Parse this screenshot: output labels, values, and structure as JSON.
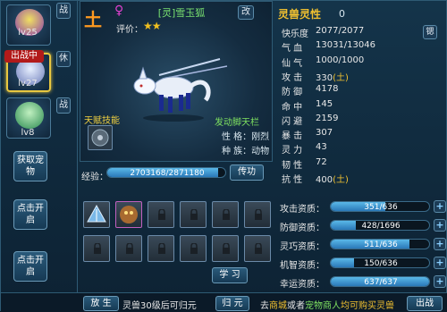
{
  "left": {
    "slots": [
      {
        "level": "lv25",
        "tag": "战"
      },
      {
        "level": "lv27",
        "tag": "休",
        "badge": "出战中"
      },
      {
        "level": "lv8",
        "tag": "战"
      }
    ],
    "get_pet_label": "获取宠物",
    "open_label_1": "点击开启",
    "open_label_2": "点击开启"
  },
  "pet": {
    "element": "土",
    "gender_icon": "female-icon",
    "name": "[灵]雪玉狐",
    "rename": "改",
    "rating_label": "评价：",
    "rating_stars": 2,
    "skills_label": "天赋技能",
    "discover_label": "发动脚天栏",
    "personality": "性 格：刚烈",
    "species": "种 族：动物"
  },
  "exp": {
    "label": "经验：",
    "text": "2703168/2871180",
    "fraction": 0.941,
    "pass_label": "传功"
  },
  "equip": {
    "learn_label": "学 习"
  },
  "spirit": {
    "title": "灵兽灵性",
    "value": "0",
    "reset": "锶",
    "stats": [
      {
        "k": "快乐度",
        "v": "2077/2077"
      },
      {
        "k": "气  血",
        "v": "13031/13046"
      },
      {
        "k": "仙  气",
        "v": "1000/1000"
      },
      {
        "k": "攻  击",
        "v": "330",
        "bonus": "(土)"
      },
      {
        "k": "防  御",
        "v": "4178"
      },
      {
        "k": "命  中",
        "v": "145"
      },
      {
        "k": "闪  避",
        "v": "2159"
      },
      {
        "k": "暴  击",
        "v": "307"
      },
      {
        "k": "灵  力",
        "v": "43"
      },
      {
        "k": "韧  性",
        "v": "72"
      },
      {
        "k": "抗  性",
        "v": "400",
        "bonus": "(土)"
      }
    ],
    "aptitudes": [
      {
        "label": "攻击资质：",
        "text": "351/636",
        "fraction": 0.552
      },
      {
        "label": "防御资质：",
        "text": "428/1696",
        "fraction": 0.252
      },
      {
        "label": "灵巧资质：",
        "text": "511/636",
        "fraction": 0.803
      },
      {
        "label": "机智资质：",
        "text": "150/636",
        "fraction": 0.236
      },
      {
        "label": "幸运资质：",
        "text": "637/637",
        "fraction": 1.0
      }
    ]
  },
  "bottom": {
    "release_label": "放 生",
    "return_notice": "灵兽30级后可归元",
    "return_label": "归 元",
    "hint_pre": "去",
    "hint_shop": "商城",
    "hint_mid": "或者",
    "hint_merchant": "宠物商人",
    "hint_post": "均可购买灵兽",
    "battle_label": "出战"
  },
  "colors": {
    "accent": "#f0c030",
    "green_text": "#7ee060",
    "active_border": "#e8c740",
    "badge_red": "#b21a1a"
  }
}
